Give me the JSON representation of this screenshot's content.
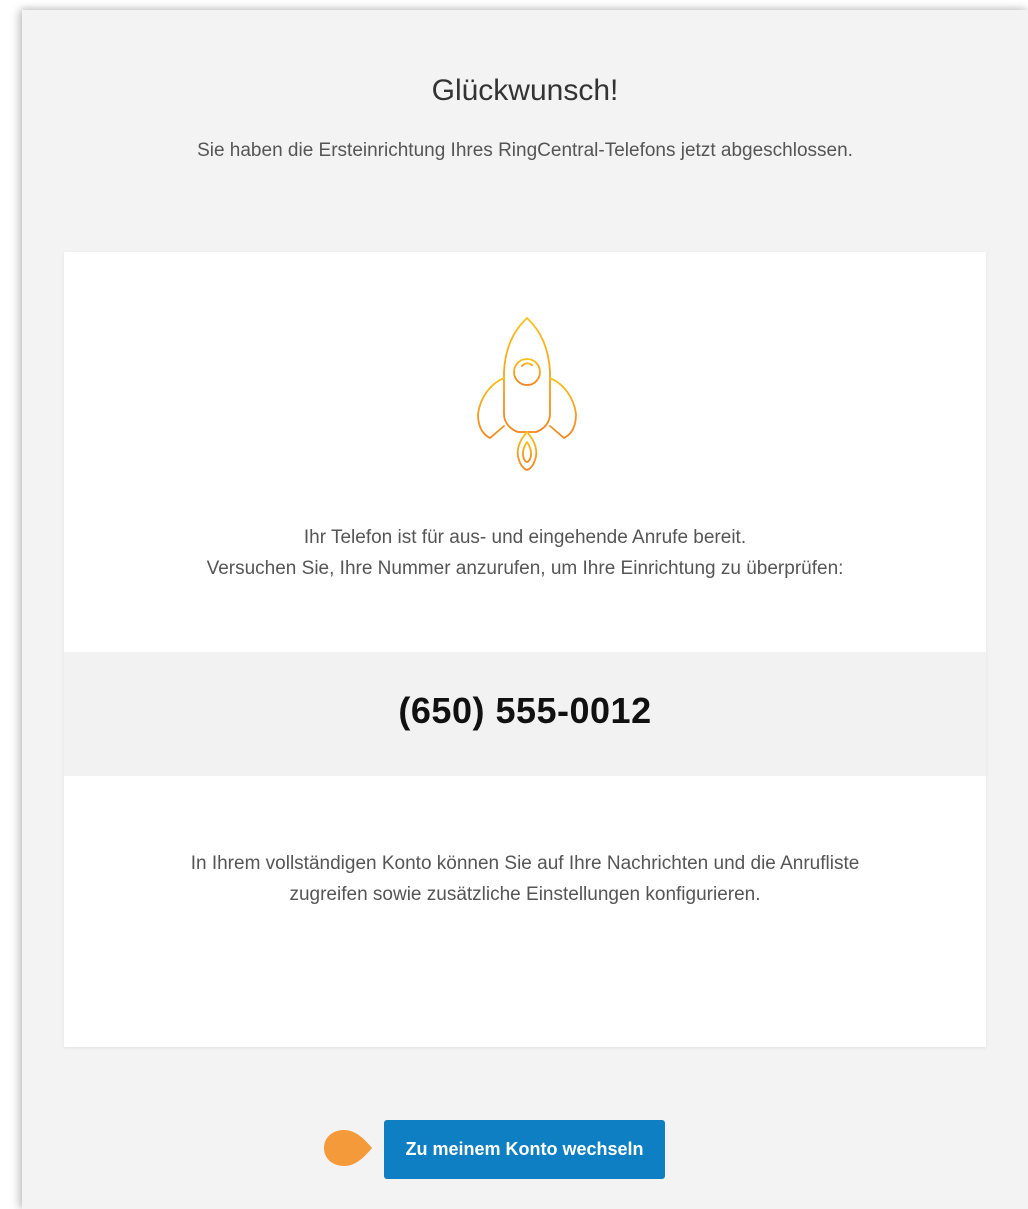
{
  "header": {
    "title": "Glückwunsch!",
    "subtitle": "Sie haben die Ersteinrichtung Ihres RingCentral-Telefons jetzt abgeschlossen."
  },
  "card": {
    "icon": "rocket-icon",
    "ready_line_1": "Ihr Telefon ist für aus- und eingehende Anrufe bereit.",
    "ready_line_2": "Versuchen Sie, Ihre Nummer anzurufen, um Ihre Einrichtung zu überprüfen:",
    "phone_number": "(650) 555-0012",
    "account_line_1": "In Ihrem vollständigen Konto können Sie auf Ihre Nachrichten und die Anrufliste",
    "account_line_2": "zugreifen sowie zusätzliche Einstellungen konfigurieren."
  },
  "actions": {
    "switch_account_label": "Zu meinem Konto wechseln",
    "pointer_icon": "pointer-marker-icon"
  },
  "colors": {
    "panel_background": "#f3f3f3",
    "button_primary": "#0e7fc2",
    "icon_gradient_top": "#f7c21b",
    "icon_gradient_bottom": "#f5841f",
    "pointer_marker": "#f59a3b"
  }
}
